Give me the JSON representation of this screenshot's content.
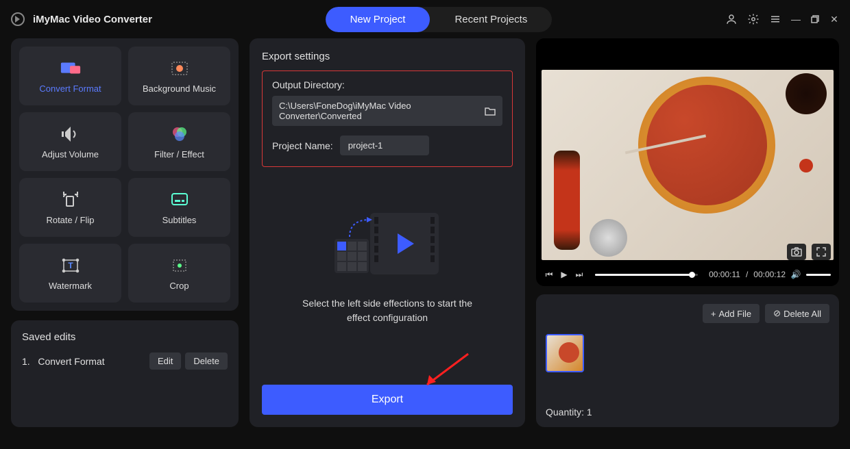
{
  "app": {
    "title": "iMyMac Video Converter"
  },
  "tabs": {
    "new_project": "New Project",
    "recent_projects": "Recent Projects"
  },
  "effects": [
    {
      "label": "Convert Format",
      "active": true
    },
    {
      "label": "Background Music"
    },
    {
      "label": "Adjust Volume"
    },
    {
      "label": "Filter / Effect"
    },
    {
      "label": "Rotate / Flip"
    },
    {
      "label": "Subtitles"
    },
    {
      "label": "Watermark"
    },
    {
      "label": "Crop"
    }
  ],
  "saved": {
    "title": "Saved edits",
    "item_prefix": "1.",
    "item_label": "Convert Format",
    "edit": "Edit",
    "delete": "Delete"
  },
  "export": {
    "settings_title": "Export settings",
    "output_dir_label": "Output Directory:",
    "output_dir_value": "C:\\Users\\FoneDog\\iMyMac Video Converter\\Converted",
    "project_name_label": "Project Name:",
    "project_name_value": "project-1",
    "hint_line1": "Select the left side effections to start the",
    "hint_line2": "effect configuration",
    "button": "Export"
  },
  "player": {
    "time_current": "00:00:11",
    "time_sep": " / ",
    "time_total": "00:00:12"
  },
  "files": {
    "add": "Add File",
    "delete": "Delete All",
    "quantity_label": "Quantity:",
    "quantity_value": "1"
  }
}
